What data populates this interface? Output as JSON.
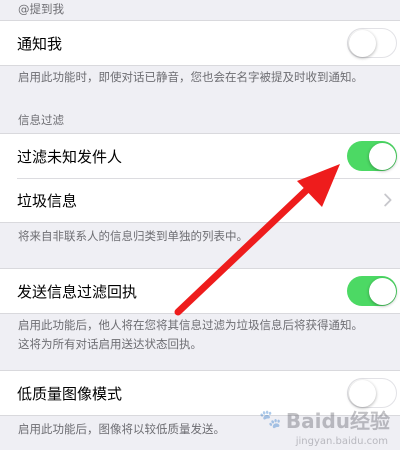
{
  "mention_section": {
    "header": "@提到我"
  },
  "notify_me": {
    "label": "通知我",
    "enabled": false
  },
  "notify_note": "启用此功能时，即使对话已静音，您也会在名字被提及时收到通知。",
  "filter_section": {
    "header": "信息过滤"
  },
  "filter_unknown": {
    "label": "过滤未知发件人",
    "enabled": true
  },
  "junk": {
    "label": "垃圾信息"
  },
  "filter_note": "将来自非联系人的信息归类到单独的列表中。",
  "send_receipt": {
    "label": "发送信息过滤回执",
    "enabled": true
  },
  "receipt_note_1": "启用此功能后，他人将在您将其信息过滤为垃圾信息后将获得通知。",
  "receipt_note_2": "这将为所有对话启用送达状态回执。",
  "low_quality": {
    "label": "低质量图像模式",
    "enabled": false
  },
  "low_quality_note": "启用此功能后，图像将以较低质量发送。",
  "watermark": {
    "text": "Baidu经验",
    "sub": "jingyan.baidu.com"
  },
  "colors": {
    "toggle_on": "#4cd964",
    "annotation_arrow": "#ee1c1c",
    "background": "#efeff4"
  }
}
